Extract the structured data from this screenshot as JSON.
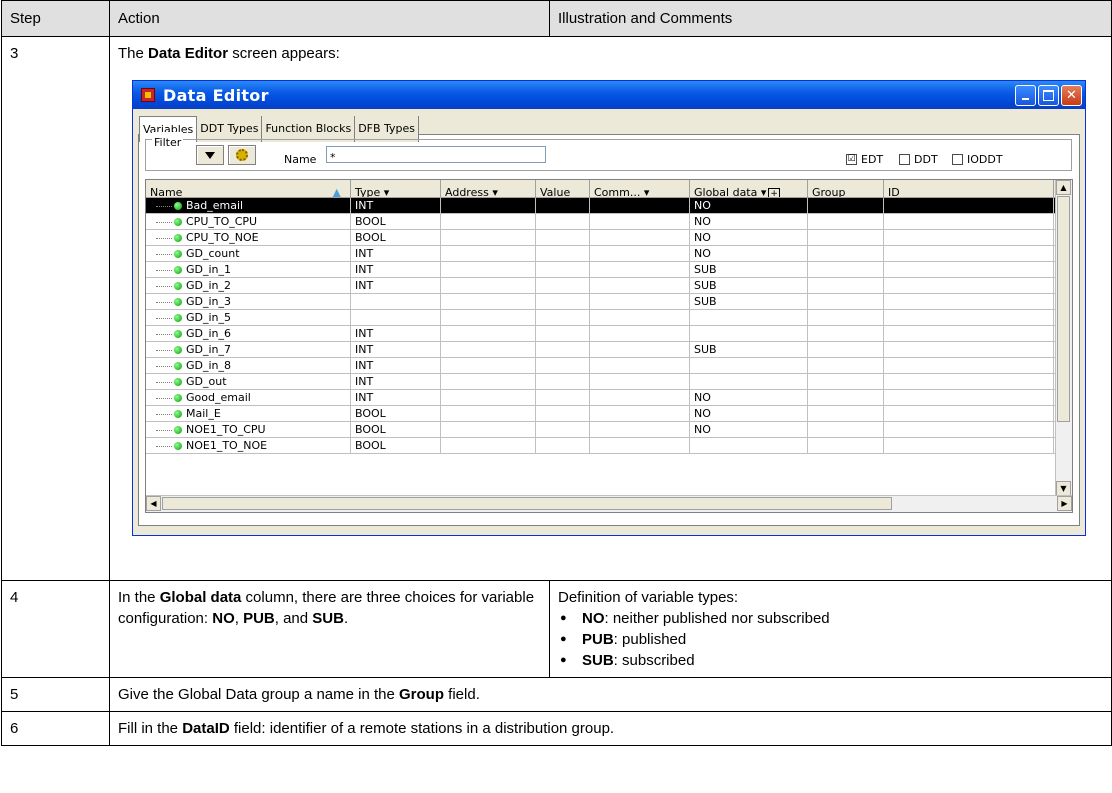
{
  "table": {
    "headers": [
      "Step",
      "Action",
      "Illustration and Comments"
    ],
    "step3": {
      "num": "3",
      "text_pre": "The ",
      "text_bold": "Data Editor",
      "text_post": " screen appears:"
    },
    "step4": {
      "num": "4",
      "action_pre": "In the ",
      "action_bold1": "Global data",
      "action_mid": " column, there are three choices for variable configuration: ",
      "action_bold2": "NO",
      "action_sep1": ", ",
      "action_bold3": "PUB",
      "action_sep2": ", and ",
      "action_bold4": "SUB",
      "action_end": ".",
      "comment_intro": "Definition of variable types:",
      "definitions": [
        {
          "term": "NO",
          "desc": ": neither published nor subscribed"
        },
        {
          "term": "PUB",
          "desc": ": published"
        },
        {
          "term": "SUB",
          "desc": ": subscribed"
        }
      ]
    },
    "step5": {
      "num": "5",
      "text_pre": "Give the Global Data group a name in the ",
      "text_bold": "Group",
      "text_post": " field."
    },
    "step6": {
      "num": "6",
      "text_pre": "Fill in the ",
      "text_bold": "DataID",
      "text_post": " field: identifier of a remote stations in a distribution group."
    }
  },
  "window": {
    "title": "Data Editor",
    "tabs": [
      "Variables",
      "DDT Types",
      "Function Blocks",
      "DFB Types"
    ],
    "filter": {
      "legend": "Filter",
      "name_label": "Name",
      "name_value": "*",
      "checkboxes": [
        {
          "label": "EDT",
          "checked": true,
          "mark": "☑"
        },
        {
          "label": "DDT",
          "checked": false,
          "mark": ""
        },
        {
          "label": "IODDT",
          "checked": false,
          "mark": ""
        }
      ]
    },
    "grid": {
      "columns": [
        "Name",
        "Type",
        "Address",
        "Value",
        "Comm...",
        "Global data",
        "Group",
        "ID"
      ],
      "rows": [
        {
          "name": "Bad_email",
          "type": "INT",
          "global": "NO"
        },
        {
          "name": "CPU_TO_CPU",
          "type": "BOOL",
          "global": "NO"
        },
        {
          "name": "CPU_TO_NOE",
          "type": "BOOL",
          "global": "NO"
        },
        {
          "name": "GD_count",
          "type": "INT",
          "global": "NO"
        },
        {
          "name": "GD_in_1",
          "type": "INT",
          "global": "SUB"
        },
        {
          "name": "GD_in_2",
          "type": "INT",
          "global": "SUB"
        },
        {
          "name": "GD_in_3",
          "type": "",
          "global": "SUB"
        },
        {
          "name": "GD_in_5",
          "type": "",
          "global": ""
        },
        {
          "name": "GD_in_6",
          "type": "INT",
          "global": ""
        },
        {
          "name": "GD_in_7",
          "type": "INT",
          "global": "SUB"
        },
        {
          "name": "GD_in_8",
          "type": "INT",
          "global": ""
        },
        {
          "name": "GD_out",
          "type": "INT",
          "global": ""
        },
        {
          "name": "Good_email",
          "type": "INT",
          "global": "NO"
        },
        {
          "name": "Mail_E",
          "type": "BOOL",
          "global": "NO"
        },
        {
          "name": "NOE1_TO_CPU",
          "type": "BOOL",
          "global": "NO"
        },
        {
          "name": "NOE1_TO_NOE",
          "type": "BOOL",
          "global": ""
        }
      ]
    }
  }
}
